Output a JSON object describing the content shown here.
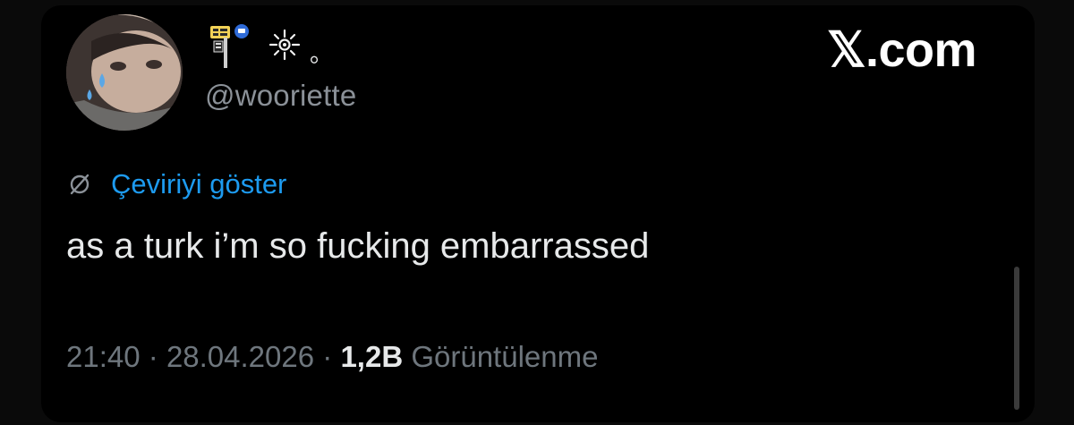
{
  "tweet": {
    "display_name_suffix": "。",
    "handle": "@wooriette",
    "translate_label": "Çeviriyi göster",
    "text": "as a turk i’m so fucking embarrassed",
    "time": "21:40",
    "separator": "·",
    "date": "28.04.2026",
    "views_count": "1,2B",
    "views_label": "Görüntülenme"
  },
  "watermark": {
    "brand": "𝕏.com"
  },
  "icons": {
    "name_emoji_1": "signpost-icon",
    "name_emoji_2": "sparkle-icon",
    "translate": "globe-icon"
  },
  "colors": {
    "background": "#000000",
    "link": "#1d9bf0",
    "muted": "#6e767d",
    "text": "#e7e9ea"
  }
}
